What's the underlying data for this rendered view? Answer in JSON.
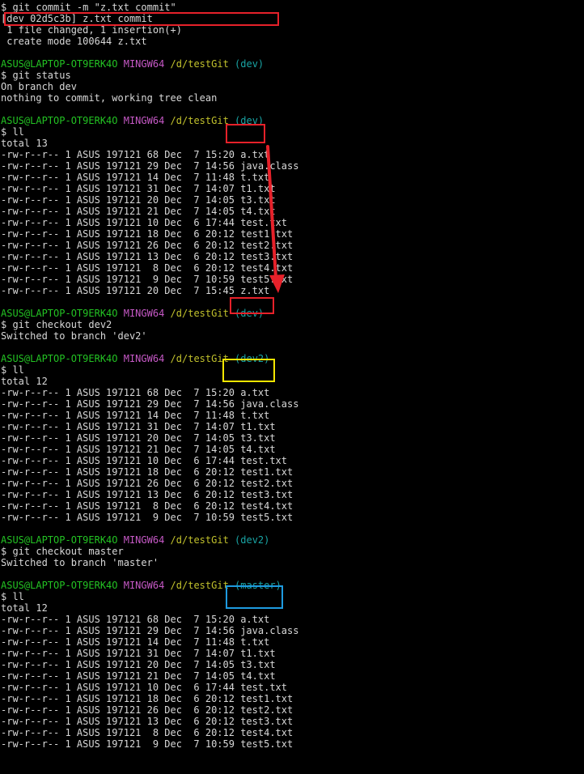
{
  "session": {
    "user_host": "ASUS@LAPTOP-OT9ERK4O",
    "system": "MINGW64",
    "path": "/d/testGit"
  },
  "colors": {
    "highlight_red": "#e6212a",
    "highlight_yellow": "#f5e600",
    "highlight_blue": "#1e9be0",
    "arrow": "#e6212a"
  },
  "lines": [
    {
      "t": "cmd",
      "text": "$ git commit -m \"z.txt commit\""
    },
    {
      "t": "out",
      "text": "[dev 02d5c3b] z.txt commit"
    },
    {
      "t": "out",
      "text": " 1 file changed, 1 insertion(+)"
    },
    {
      "t": "out",
      "text": " create mode 100644 z.txt"
    },
    {
      "t": "blank",
      "text": ""
    },
    {
      "t": "prompt",
      "branch": "(dev)"
    },
    {
      "t": "cmd",
      "text": "$ git status"
    },
    {
      "t": "out",
      "text": "On branch dev"
    },
    {
      "t": "out",
      "text": "nothing to commit, working tree clean"
    },
    {
      "t": "blank",
      "text": ""
    },
    {
      "t": "prompt",
      "branch": "(dev)"
    },
    {
      "t": "cmd",
      "text": "$ ll"
    },
    {
      "t": "out",
      "text": "total 13"
    },
    {
      "t": "out",
      "text": "-rw-r--r-- 1 ASUS 197121 68 Dec  7 15:20 a.txt"
    },
    {
      "t": "out",
      "text": "-rw-r--r-- 1 ASUS 197121 29 Dec  7 14:56 java.class"
    },
    {
      "t": "out",
      "text": "-rw-r--r-- 1 ASUS 197121 14 Dec  7 11:48 t.txt"
    },
    {
      "t": "out",
      "text": "-rw-r--r-- 1 ASUS 197121 31 Dec  7 14:07 t1.txt"
    },
    {
      "t": "out",
      "text": "-rw-r--r-- 1 ASUS 197121 20 Dec  7 14:05 t3.txt"
    },
    {
      "t": "out",
      "text": "-rw-r--r-- 1 ASUS 197121 21 Dec  7 14:05 t4.txt"
    },
    {
      "t": "out",
      "text": "-rw-r--r-- 1 ASUS 197121 10 Dec  6 17:44 test.txt"
    },
    {
      "t": "out",
      "text": "-rw-r--r-- 1 ASUS 197121 18 Dec  6 20:12 test1.txt"
    },
    {
      "t": "out",
      "text": "-rw-r--r-- 1 ASUS 197121 26 Dec  6 20:12 test2.txt"
    },
    {
      "t": "out",
      "text": "-rw-r--r-- 1 ASUS 197121 13 Dec  6 20:12 test3.txt"
    },
    {
      "t": "out",
      "text": "-rw-r--r-- 1 ASUS 197121  8 Dec  6 20:12 test4.txt"
    },
    {
      "t": "out",
      "text": "-rw-r--r-- 1 ASUS 197121  9 Dec  7 10:59 test5.txt"
    },
    {
      "t": "out",
      "text": "-rw-r--r-- 1 ASUS 197121 20 Dec  7 15:45 z.txt"
    },
    {
      "t": "blank",
      "text": ""
    },
    {
      "t": "prompt",
      "branch": "(dev)"
    },
    {
      "t": "cmd",
      "text": "$ git checkout dev2"
    },
    {
      "t": "out",
      "text": "Switched to branch 'dev2'"
    },
    {
      "t": "blank",
      "text": ""
    },
    {
      "t": "prompt",
      "branch": "(dev2)"
    },
    {
      "t": "cmd",
      "text": "$ ll"
    },
    {
      "t": "out",
      "text": "total 12"
    },
    {
      "t": "out",
      "text": "-rw-r--r-- 1 ASUS 197121 68 Dec  7 15:20 a.txt"
    },
    {
      "t": "out",
      "text": "-rw-r--r-- 1 ASUS 197121 29 Dec  7 14:56 java.class"
    },
    {
      "t": "out",
      "text": "-rw-r--r-- 1 ASUS 197121 14 Dec  7 11:48 t.txt"
    },
    {
      "t": "out",
      "text": "-rw-r--r-- 1 ASUS 197121 31 Dec  7 14:07 t1.txt"
    },
    {
      "t": "out",
      "text": "-rw-r--r-- 1 ASUS 197121 20 Dec  7 14:05 t3.txt"
    },
    {
      "t": "out",
      "text": "-rw-r--r-- 1 ASUS 197121 21 Dec  7 14:05 t4.txt"
    },
    {
      "t": "out",
      "text": "-rw-r--r-- 1 ASUS 197121 10 Dec  6 17:44 test.txt"
    },
    {
      "t": "out",
      "text": "-rw-r--r-- 1 ASUS 197121 18 Dec  6 20:12 test1.txt"
    },
    {
      "t": "out",
      "text": "-rw-r--r-- 1 ASUS 197121 26 Dec  6 20:12 test2.txt"
    },
    {
      "t": "out",
      "text": "-rw-r--r-- 1 ASUS 197121 13 Dec  6 20:12 test3.txt"
    },
    {
      "t": "out",
      "text": "-rw-r--r-- 1 ASUS 197121  8 Dec  6 20:12 test4.txt"
    },
    {
      "t": "out",
      "text": "-rw-r--r-- 1 ASUS 197121  9 Dec  7 10:59 test5.txt"
    },
    {
      "t": "blank",
      "text": ""
    },
    {
      "t": "prompt",
      "branch": "(dev2)"
    },
    {
      "t": "cmd",
      "text": "$ git checkout master"
    },
    {
      "t": "out",
      "text": "Switched to branch 'master'"
    },
    {
      "t": "blank",
      "text": ""
    },
    {
      "t": "prompt",
      "branch": "(master)"
    },
    {
      "t": "cmd",
      "text": "$ ll"
    },
    {
      "t": "out",
      "text": "total 12"
    },
    {
      "t": "out",
      "text": "-rw-r--r-- 1 ASUS 197121 68 Dec  7 15:20 a.txt"
    },
    {
      "t": "out",
      "text": "-rw-r--r-- 1 ASUS 197121 29 Dec  7 14:56 java.class"
    },
    {
      "t": "out",
      "text": "-rw-r--r-- 1 ASUS 197121 14 Dec  7 11:48 t.txt"
    },
    {
      "t": "out",
      "text": "-rw-r--r-- 1 ASUS 197121 31 Dec  7 14:07 t1.txt"
    },
    {
      "t": "out",
      "text": "-rw-r--r-- 1 ASUS 197121 20 Dec  7 14:05 t3.txt"
    },
    {
      "t": "out",
      "text": "-rw-r--r-- 1 ASUS 197121 21 Dec  7 14:05 t4.txt"
    },
    {
      "t": "out",
      "text": "-rw-r--r-- 1 ASUS 197121 10 Dec  6 17:44 test.txt"
    },
    {
      "t": "out",
      "text": "-rw-r--r-- 1 ASUS 197121 18 Dec  6 20:12 test1.txt"
    },
    {
      "t": "out",
      "text": "-rw-r--r-- 1 ASUS 197121 26 Dec  6 20:12 test2.txt"
    },
    {
      "t": "out",
      "text": "-rw-r--r-- 1 ASUS 197121 13 Dec  6 20:12 test3.txt"
    },
    {
      "t": "out",
      "text": "-rw-r--r-- 1 ASUS 197121  8 Dec  6 20:12 test4.txt"
    },
    {
      "t": "out",
      "text": "-rw-r--r-- 1 ASUS 197121  9 Dec  7 10:59 test5.txt"
    }
  ]
}
